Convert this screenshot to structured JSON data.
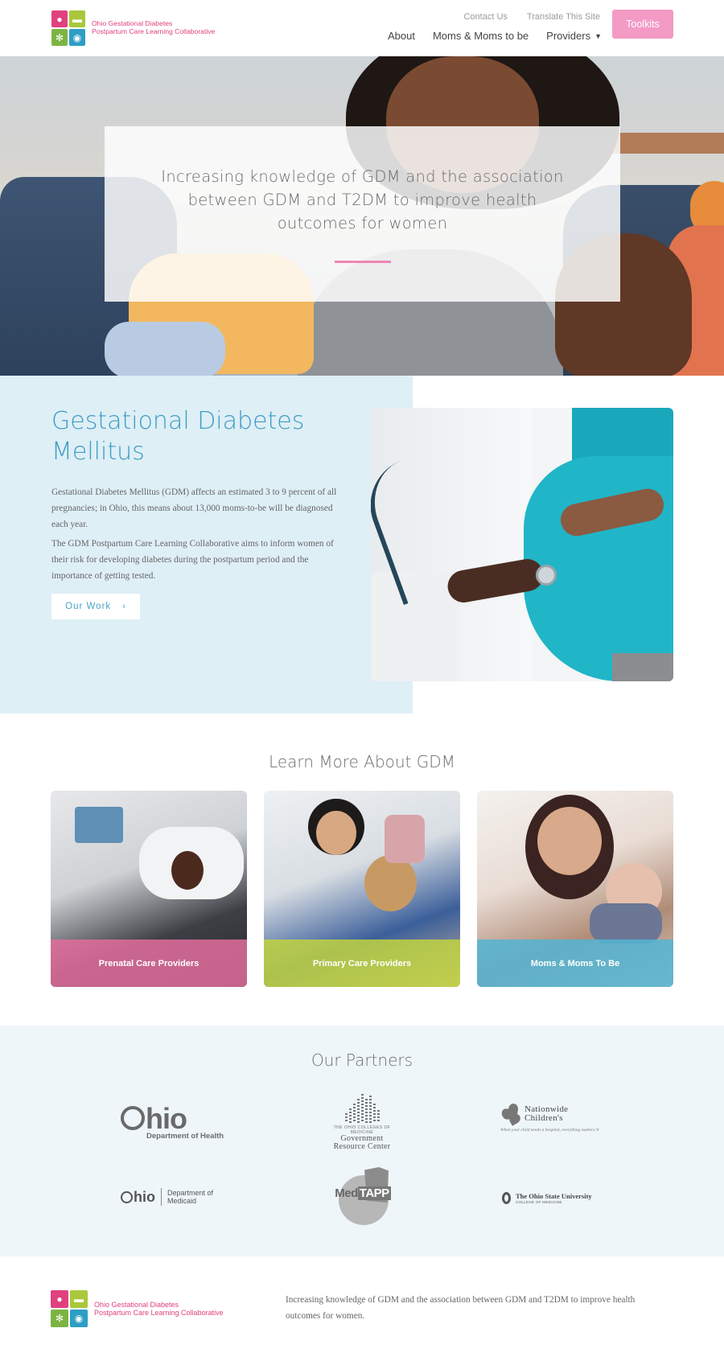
{
  "header": {
    "logo_line1": "Ohio Gestational Diabetes",
    "logo_line2": "Postpartum Care Learning Collaborative",
    "utility_links": [
      "Contact Us",
      "Translate This Site"
    ],
    "nav": [
      {
        "label": "About"
      },
      {
        "label": "Moms & Moms to be"
      },
      {
        "label": "Providers"
      }
    ],
    "cta_label": "Toolkits",
    "cta_color": "#f39ac5"
  },
  "hero": {
    "text": "Increasing knowledge of GDM and the association between GDM and T2DM to improve health outcomes for women",
    "accent_color": "#ee86b5"
  },
  "gdm": {
    "title": "Gestational Diabetes Mellitus",
    "paragraphs": [
      "Gestational Diabetes Mellitus (GDM) affects an estimated 3 to 9 percent of all pregnancies; in Ohio, this means about 13,000 moms-to-be will be diagnosed each year.",
      "The GDM Postpartum Care Learning Collaborative aims to inform women of their risk for developing diabetes during the postpartum period and the importance of getting tested."
    ],
    "button_label": "Our Work",
    "title_color": "#3e9cc2",
    "panel_color": "#deeff6"
  },
  "learn_more": {
    "title": "Learn More About GDM",
    "cards": [
      {
        "label": "Prenatal Care Providers",
        "color": "#e26d9d"
      },
      {
        "label": "Primary Care Providers",
        "color": "#c1d43f"
      },
      {
        "label": "Moms & Moms To Be",
        "color": "#52b5d3"
      }
    ]
  },
  "partners": {
    "title": "Our Partners",
    "ohio_health": {
      "word": "hio",
      "sub": "Department of Health"
    },
    "grc": {
      "small": "THE OHIO COLLEGES OF MEDICINE",
      "line1": "Government",
      "line2": "Resource Center"
    },
    "nationwide": {
      "line1": "Nationwide",
      "line2": "Children's",
      "tagline": "When your child needs a hospital, everything matters.®"
    },
    "ohio_medicaid": {
      "word": "hio",
      "dept_line1": "Department of",
      "dept_line2": "Medicaid"
    },
    "medtapp": {
      "med": "Med",
      "tapp": "TAPP"
    },
    "osu": {
      "line1": "The Ohio State University",
      "line2": "COLLEGE OF MEDICINE"
    }
  },
  "footer": {
    "logo_line1": "Ohio Gestational Diabetes",
    "logo_line2": "Postpartum Care Learning Collaborative",
    "text": "Increasing knowledge of GDM and the association between GDM and T2DM to improve health outcomes for women."
  }
}
